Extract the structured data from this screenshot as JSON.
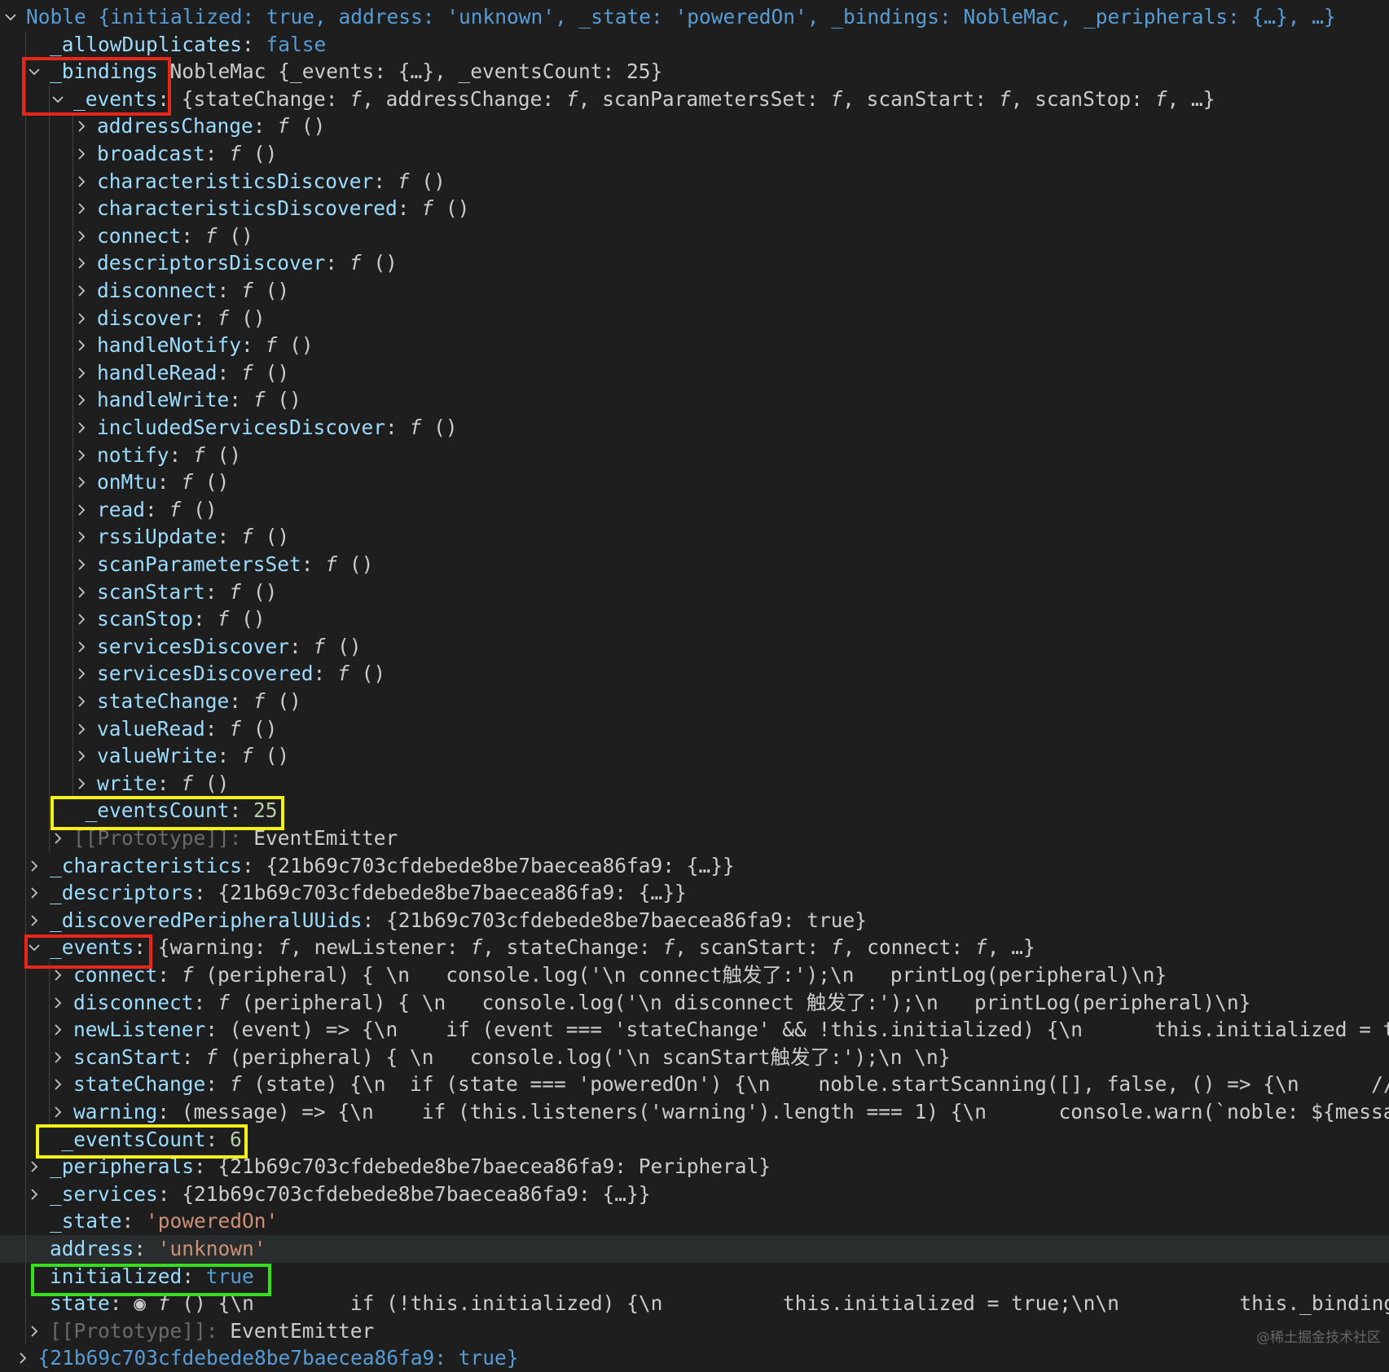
{
  "colors": {
    "background": "#1e1e1e",
    "key": "#9cdcfe",
    "keyword": "#569cd6",
    "string": "#ce9178",
    "number": "#b5cea8",
    "text": "#cccccc",
    "dim": "#6a6a6a",
    "red_box": "#e8261c",
    "yellow_box": "#f5f016",
    "green_box": "#34e01a"
  },
  "rows": [
    {
      "level": 0,
      "chevron": "down",
      "segs": [
        {
          "t": "Noble {initialized: true, address: 'unknown', _state: 'poweredOn', _bindings: NobleMac, _peripherals: {…}, …}",
          "c": "blue"
        }
      ]
    },
    {
      "level": 1,
      "chevron": "none",
      "segs": [
        {
          "t": "_allowDuplicates",
          "c": "k"
        },
        {
          "t": ": ",
          "c": "sub"
        },
        {
          "t": "false",
          "c": "blue"
        }
      ]
    },
    {
      "level": 1,
      "chevron": "down",
      "segs": [
        {
          "t": "_bindings",
          "c": "k"
        },
        {
          "t": " ",
          "c": "sub"
        },
        {
          "t": "NobleMac {_events: {…}, _eventsCount: 25}",
          "c": "sub"
        }
      ]
    },
    {
      "level": 2,
      "chevron": "down",
      "segs": [
        {
          "t": "_events",
          "c": "k"
        },
        {
          "t": ": ",
          "c": "sub"
        },
        {
          "t": "{stateChange: ",
          "c": "sub"
        },
        {
          "t": "f",
          "c": "ital"
        },
        {
          "t": ", addressChange: ",
          "c": "sub"
        },
        {
          "t": "f",
          "c": "ital"
        },
        {
          "t": ", scanParametersSet: ",
          "c": "sub"
        },
        {
          "t": "f",
          "c": "ital"
        },
        {
          "t": ", scanStart: ",
          "c": "sub"
        },
        {
          "t": "f",
          "c": "ital"
        },
        {
          "t": ", scanStop: ",
          "c": "sub"
        },
        {
          "t": "f",
          "c": "ital"
        },
        {
          "t": ", …}",
          "c": "sub"
        }
      ]
    },
    {
      "level": 3,
      "chevron": "right",
      "fn": "addressChange"
    },
    {
      "level": 3,
      "chevron": "right",
      "fn": "broadcast"
    },
    {
      "level": 3,
      "chevron": "right",
      "fn": "characteristicsDiscover"
    },
    {
      "level": 3,
      "chevron": "right",
      "fn": "characteristicsDiscovered"
    },
    {
      "level": 3,
      "chevron": "right",
      "fn": "connect"
    },
    {
      "level": 3,
      "chevron": "right",
      "fn": "descriptorsDiscover"
    },
    {
      "level": 3,
      "chevron": "right",
      "fn": "disconnect"
    },
    {
      "level": 3,
      "chevron": "right",
      "fn": "discover"
    },
    {
      "level": 3,
      "chevron": "right",
      "fn": "handleNotify"
    },
    {
      "level": 3,
      "chevron": "right",
      "fn": "handleRead"
    },
    {
      "level": 3,
      "chevron": "right",
      "fn": "handleWrite"
    },
    {
      "level": 3,
      "chevron": "right",
      "fn": "includedServicesDiscover"
    },
    {
      "level": 3,
      "chevron": "right",
      "fn": "notify"
    },
    {
      "level": 3,
      "chevron": "right",
      "fn": "onMtu"
    },
    {
      "level": 3,
      "chevron": "right",
      "fn": "read"
    },
    {
      "level": 3,
      "chevron": "right",
      "fn": "rssiUpdate"
    },
    {
      "level": 3,
      "chevron": "right",
      "fn": "scanParametersSet"
    },
    {
      "level": 3,
      "chevron": "right",
      "fn": "scanStart"
    },
    {
      "level": 3,
      "chevron": "right",
      "fn": "scanStop"
    },
    {
      "level": 3,
      "chevron": "right",
      "fn": "servicesDiscover"
    },
    {
      "level": 3,
      "chevron": "right",
      "fn": "servicesDiscovered"
    },
    {
      "level": 3,
      "chevron": "right",
      "fn": "stateChange"
    },
    {
      "level": 3,
      "chevron": "right",
      "fn": "valueRead"
    },
    {
      "level": 3,
      "chevron": "right",
      "fn": "valueWrite"
    },
    {
      "level": 3,
      "chevron": "right",
      "fn": "write"
    },
    {
      "level": 2.5,
      "chevron": "none",
      "segs": [
        {
          "t": "_eventsCount",
          "c": "k"
        },
        {
          "t": ": ",
          "c": "sub"
        },
        {
          "t": "25",
          "c": "num"
        }
      ]
    },
    {
      "level": 2,
      "chevron": "right",
      "segs": [
        {
          "t": "[[Prototype]]",
          "c": "dim"
        },
        {
          "t": ": ",
          "c": "dim"
        },
        {
          "t": "EventEmitter",
          "c": "sub"
        }
      ]
    },
    {
      "level": 1,
      "chevron": "right",
      "segs": [
        {
          "t": "_characteristics",
          "c": "k"
        },
        {
          "t": ": ",
          "c": "sub"
        },
        {
          "t": "{21b69c703cfdebede8be7baecea86fa9: {…}}",
          "c": "sub"
        }
      ]
    },
    {
      "level": 1,
      "chevron": "right",
      "segs": [
        {
          "t": "_descriptors",
          "c": "k"
        },
        {
          "t": ": ",
          "c": "sub"
        },
        {
          "t": "{21b69c703cfdebede8be7baecea86fa9: {…}}",
          "c": "sub"
        }
      ]
    },
    {
      "level": 1,
      "chevron": "right",
      "segs": [
        {
          "t": "_discoveredPeripheralUUids",
          "c": "k"
        },
        {
          "t": ": ",
          "c": "sub"
        },
        {
          "t": "{21b69c703cfdebede8be7baecea86fa9: true}",
          "c": "sub"
        }
      ]
    },
    {
      "level": 1,
      "chevron": "down",
      "segs": [
        {
          "t": "_events",
          "c": "k"
        },
        {
          "t": ": ",
          "c": "sub"
        },
        {
          "t": "{warning: ",
          "c": "sub"
        },
        {
          "t": "f",
          "c": "ital"
        },
        {
          "t": ", newListener: ",
          "c": "sub"
        },
        {
          "t": "f",
          "c": "ital"
        },
        {
          "t": ", stateChange: ",
          "c": "sub"
        },
        {
          "t": "f",
          "c": "ital"
        },
        {
          "t": ", scanStart: ",
          "c": "sub"
        },
        {
          "t": "f",
          "c": "ital"
        },
        {
          "t": ", connect: ",
          "c": "sub"
        },
        {
          "t": "f",
          "c": "ital"
        },
        {
          "t": ", …}",
          "c": "sub"
        }
      ]
    },
    {
      "level": 2,
      "chevron": "right",
      "segs": [
        {
          "t": "connect",
          "c": "k"
        },
        {
          "t": ": ",
          "c": "sub"
        },
        {
          "t": "f",
          "c": "ital"
        },
        {
          "t": " (peripheral) { \\n   console.log('\\n connect触发了:');\\n   printLog(peripheral)\\n}",
          "c": "sub"
        }
      ]
    },
    {
      "level": 2,
      "chevron": "right",
      "segs": [
        {
          "t": "disconnect",
          "c": "k"
        },
        {
          "t": ": ",
          "c": "sub"
        },
        {
          "t": "f",
          "c": "ital"
        },
        {
          "t": " (peripheral) { \\n   console.log('\\n disconnect 触发了:');\\n   printLog(peripheral)\\n}",
          "c": "sub"
        }
      ]
    },
    {
      "level": 2,
      "chevron": "right",
      "segs": [
        {
          "t": "newListener",
          "c": "k"
        },
        {
          "t": ": ",
          "c": "sub"
        },
        {
          "t": "(event) => {\\n    if (event === 'stateChange' && !this.initialized) {\\n      this.initialized = true",
          "c": "sub"
        }
      ]
    },
    {
      "level": 2,
      "chevron": "right",
      "segs": [
        {
          "t": "scanStart",
          "c": "k"
        },
        {
          "t": ": ",
          "c": "sub"
        },
        {
          "t": "f",
          "c": "ital"
        },
        {
          "t": " (peripheral) { \\n   console.log('\\n scanStart触发了:');\\n \\n}",
          "c": "sub"
        }
      ]
    },
    {
      "level": 2,
      "chevron": "right",
      "segs": [
        {
          "t": "stateChange",
          "c": "k"
        },
        {
          "t": ": ",
          "c": "sub"
        },
        {
          "t": "f",
          "c": "ital"
        },
        {
          "t": " (state) {\\n  if (state === 'poweredOn') {\\n    noble.startScanning([], false, () => {\\n      // no",
          "c": "sub"
        }
      ]
    },
    {
      "level": 2,
      "chevron": "right",
      "segs": [
        {
          "t": "warning",
          "c": "k"
        },
        {
          "t": ": ",
          "c": "sub"
        },
        {
          "t": "(message) => {\\n    if (this.listeners('warning').length === 1) {\\n      console.warn(`noble: ${message}",
          "c": "sub"
        }
      ]
    },
    {
      "level": 1.5,
      "chevron": "none",
      "segs": [
        {
          "t": "_eventsCount",
          "c": "k"
        },
        {
          "t": ": ",
          "c": "sub"
        },
        {
          "t": "6",
          "c": "num"
        }
      ]
    },
    {
      "level": 1,
      "chevron": "right",
      "segs": [
        {
          "t": "_peripherals",
          "c": "k"
        },
        {
          "t": ": ",
          "c": "sub"
        },
        {
          "t": "{21b69c703cfdebede8be7baecea86fa9: Peripheral}",
          "c": "sub"
        }
      ]
    },
    {
      "level": 1,
      "chevron": "right",
      "segs": [
        {
          "t": "_services",
          "c": "k"
        },
        {
          "t": ": ",
          "c": "sub"
        },
        {
          "t": "{21b69c703cfdebede8be7baecea86fa9: {…}}",
          "c": "sub"
        }
      ]
    },
    {
      "level": 1,
      "chevron": "none",
      "segs": [
        {
          "t": "_state",
          "c": "k"
        },
        {
          "t": ": ",
          "c": "sub"
        },
        {
          "t": "'poweredOn'",
          "c": "str"
        }
      ]
    },
    {
      "level": 1,
      "chevron": "none",
      "highlight": true,
      "segs": [
        {
          "t": "address",
          "c": "k"
        },
        {
          "t": ": ",
          "c": "sub"
        },
        {
          "t": "'unknown'",
          "c": "str"
        }
      ]
    },
    {
      "level": 1,
      "chevron": "none",
      "segs": [
        {
          "t": "initialized",
          "c": "k"
        },
        {
          "t": ": ",
          "c": "sub"
        },
        {
          "t": "true",
          "c": "blue"
        }
      ]
    },
    {
      "level": 1,
      "chevron": "none",
      "segs": [
        {
          "t": "state",
          "c": "k"
        },
        {
          "t": ": ",
          "c": "sub"
        },
        {
          "t": "◉ ",
          "c": "sub",
          "icon": "eye-icon"
        },
        {
          "t": "f",
          "c": "ital"
        },
        {
          "t": " () {\\n        if (!this.initialized) {\\n          this.initialized = true;\\n\\n          this._bindings",
          "c": "sub"
        }
      ]
    },
    {
      "level": 1,
      "chevron": "right",
      "segs": [
        {
          "t": "[[Prototype]]",
          "c": "dim"
        },
        {
          "t": ": ",
          "c": "dim"
        },
        {
          "t": "EventEmitter",
          "c": "sub"
        }
      ]
    },
    {
      "level": 0.5,
      "chevron": "right",
      "segs": [
        {
          "t": "{21b69c703cfdebede8be7baecea86fa9: true}",
          "c": "blue"
        }
      ]
    }
  ],
  "fn_suffix": "()",
  "fn_label": "f",
  "watermark": "@稀土掘金技术社区"
}
